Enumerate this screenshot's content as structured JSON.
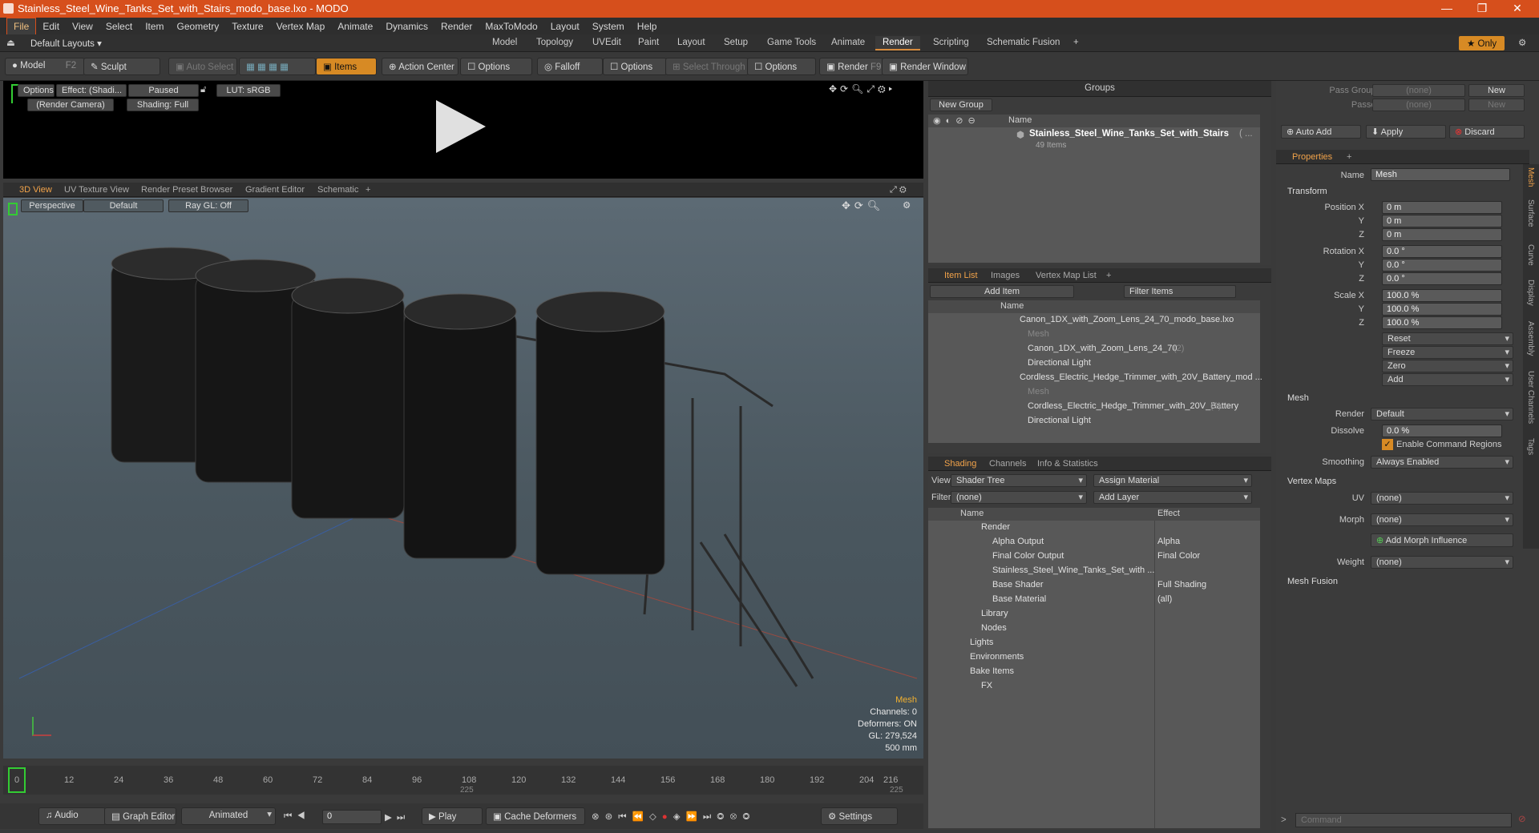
{
  "window": {
    "title": "Stainless_Steel_Wine_Tanks_Set_with_Stairs_modo_base.lxo - MODO"
  },
  "menu": [
    "File",
    "Edit",
    "View",
    "Select",
    "Item",
    "Geometry",
    "Texture",
    "Vertex Map",
    "Animate",
    "Dynamics",
    "Render",
    "MaxToModo",
    "Layout",
    "System",
    "Help"
  ],
  "layout_bar": {
    "default_layouts": "Default Layouts ▾",
    "tabs": [
      "Model",
      "Topology",
      "UVEdit",
      "Paint",
      "Layout",
      "Setup",
      "Game Tools",
      "Animate",
      "Render",
      "Scripting",
      "Schematic Fusion"
    ],
    "active_tab": "Render",
    "only": "★ Only"
  },
  "toolbar": {
    "model": "Model",
    "model_key": "F2",
    "sculpt": "Sculpt",
    "auto_select": "Auto Select",
    "items": "Items",
    "action_center": "Action Center",
    "options1": "Options",
    "falloff": "Falloff",
    "options2": "Options",
    "select_through": "Select Through",
    "options3": "Options",
    "render": "Render",
    "render_key": "F9",
    "render_window": "Render Window"
  },
  "render_preview": {
    "options": "Options",
    "effect": "Effect: (Shadi...",
    "paused": "Paused",
    "lut": "LUT: sRGB",
    "camera": "(Render Camera)",
    "shading": "Shading: Full"
  },
  "viewport_tabs": [
    "3D View",
    "UV Texture View",
    "Render Preset Browser",
    "Gradient Editor",
    "Schematic"
  ],
  "viewport": {
    "perspective": "Perspective",
    "default": "Default",
    "raygl": "Ray GL: Off",
    "stats": [
      "Mesh",
      "Channels: 0",
      "Deformers: ON",
      "GL: 279,524",
      "500 mm"
    ]
  },
  "timeline": {
    "ticks": [
      "0",
      "12",
      "24",
      "36",
      "48",
      "60",
      "72",
      "84",
      "96",
      "108",
      "120",
      "132",
      "144",
      "156",
      "168",
      "180",
      "192",
      "204",
      "216"
    ],
    "sub_ticks": [
      "225",
      "225"
    ]
  },
  "bottom_bar": {
    "audio": "Audio",
    "graph_editor": "Graph Editor",
    "animated": "Animated",
    "frame": "0",
    "play": "Play",
    "cache_deformers": "Cache Deformers",
    "settings": "Settings"
  },
  "groups": {
    "header": "Groups",
    "new_group": "New Group",
    "col_name": "Name",
    "item_name": "Stainless_Steel_Wine_Tanks_Set_with_Stairs",
    "item_suffix": "( ...",
    "item_count": "49 Items"
  },
  "item_list": {
    "tabs": [
      "Item List",
      "Images",
      "Vertex Map List"
    ],
    "add_item": "Add Item",
    "filter_items": "Filter Items",
    "col_name": "Name",
    "rows": [
      "Canon_1DX_with_Zoom_Lens_24_70_modo_base.lxo",
      "Mesh",
      "Canon_1DX_with_Zoom_Lens_24_70",
      "Directional Light",
      "Cordless_Electric_Hedge_Trimmer_with_20V_Battery_mod ...",
      "Mesh",
      "Cordless_Electric_Hedge_Trimmer_with_20V_Battery",
      "Directional Light"
    ],
    "counts": [
      "(2)",
      "(2)"
    ]
  },
  "shading": {
    "tabs": [
      "Shading",
      "Channels",
      "Info & Statistics"
    ],
    "view_label": "View",
    "view_value": "Shader Tree",
    "assign_material": "Assign Material",
    "filter_label": "Filter",
    "filter_value": "(none)",
    "add_layer": "Add Layer",
    "col_name": "Name",
    "col_effect": "Effect",
    "rows": [
      {
        "name": "Render",
        "effect": ""
      },
      {
        "name": "Alpha Output",
        "effect": "Alpha"
      },
      {
        "name": "Final Color Output",
        "effect": "Final Color"
      },
      {
        "name": "Stainless_Steel_Wine_Tanks_Set_with ...",
        "effect": ""
      },
      {
        "name": "Base Shader",
        "effect": "Full Shading"
      },
      {
        "name": "Base Material",
        "effect": "(all)"
      },
      {
        "name": "Library",
        "effect": ""
      },
      {
        "name": "Nodes",
        "effect": ""
      },
      {
        "name": "Lights",
        "effect": ""
      },
      {
        "name": "Environments",
        "effect": ""
      },
      {
        "name": "Bake Items",
        "effect": ""
      },
      {
        "name": "FX",
        "effect": ""
      }
    ]
  },
  "pass": {
    "pass_groups": "Pass Groups",
    "passes": "Passes",
    "none": "(none)",
    "new": "New",
    "auto_add": "Auto Add",
    "apply": "Apply",
    "discard": "Discard"
  },
  "properties": {
    "tab": "Properties",
    "name_label": "Name",
    "name_value": "Mesh",
    "transform": "Transform",
    "position_label": "Position X",
    "pos": [
      "0 m",
      "0 m",
      "0 m"
    ],
    "rotation_label": "Rotation X",
    "rot": [
      "0.0 °",
      "0.0 °",
      "0.0 °"
    ],
    "scale_label": "Scale X",
    "scale": [
      "100.0 %",
      "100.0 %",
      "100.0 %"
    ],
    "y": "Y",
    "z": "Z",
    "actions": [
      "Reset",
      "Freeze",
      "Zero",
      "Add"
    ],
    "mesh": "Mesh",
    "render_label": "Render",
    "render_value": "Default",
    "dissolve_label": "Dissolve",
    "dissolve_value": "0.0 %",
    "enable_cmd": "Enable Command Regions",
    "smoothing_label": "Smoothing",
    "smoothing_value": "Always Enabled",
    "vertex_maps": "Vertex Maps",
    "uv_label": "UV",
    "uv_value": "(none)",
    "morph_label": "Morph",
    "morph_value": "(none)",
    "add_morph": "Add Morph Influence",
    "weight_label": "Weight",
    "weight_value": "(none)",
    "mesh_fusion": "Mesh Fusion",
    "side_tabs": [
      "Mesh",
      "Surface",
      "Curve",
      "Display",
      "Assembly",
      "User Channels",
      "Tags"
    ]
  },
  "command": {
    "placeholder": "Command"
  }
}
